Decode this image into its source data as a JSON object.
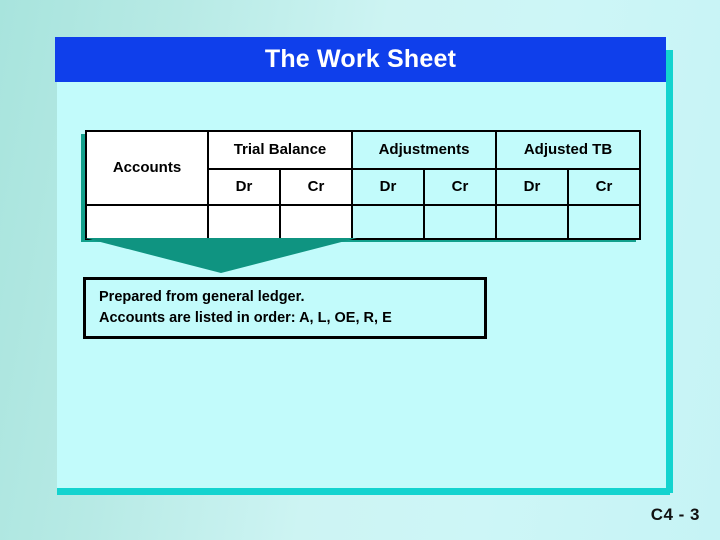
{
  "slide": {
    "title": "The Work Sheet",
    "slide_number": "C4 - 3",
    "colors": {
      "title_bar": "#0F3FEB",
      "title_text": "#FFFFFF",
      "frame_line": "#13D3CF",
      "arrow_teal": "#0F9481",
      "panel_background": "#C2FBFB",
      "table_white": "#FFFFFF",
      "border": "#000000"
    }
  },
  "worksheet": {
    "name": "work-sheet-table",
    "row_label": "Accounts",
    "group_headers": [
      {
        "label": "Trial Balance",
        "shade": "white"
      },
      {
        "label": "Adjustments",
        "shade": "cyan"
      },
      {
        "label": "Adjusted TB",
        "shade": "cyan"
      }
    ],
    "sub_headers": [
      {
        "label": "Dr",
        "shade": "white"
      },
      {
        "label": "Cr",
        "shade": "white"
      },
      {
        "label": "Dr",
        "shade": "cyan"
      },
      {
        "label": "Cr",
        "shade": "cyan"
      },
      {
        "label": "Dr",
        "shade": "cyan"
      },
      {
        "label": "Cr",
        "shade": "cyan"
      }
    ],
    "body_rows": [
      {
        "cells": [
          "",
          "",
          "",
          "",
          "",
          "",
          ""
        ]
      }
    ]
  },
  "callout": {
    "line1": "Prepared from general ledger.",
    "line2": "Accounts are listed in order:  A, L, OE, R, E"
  }
}
